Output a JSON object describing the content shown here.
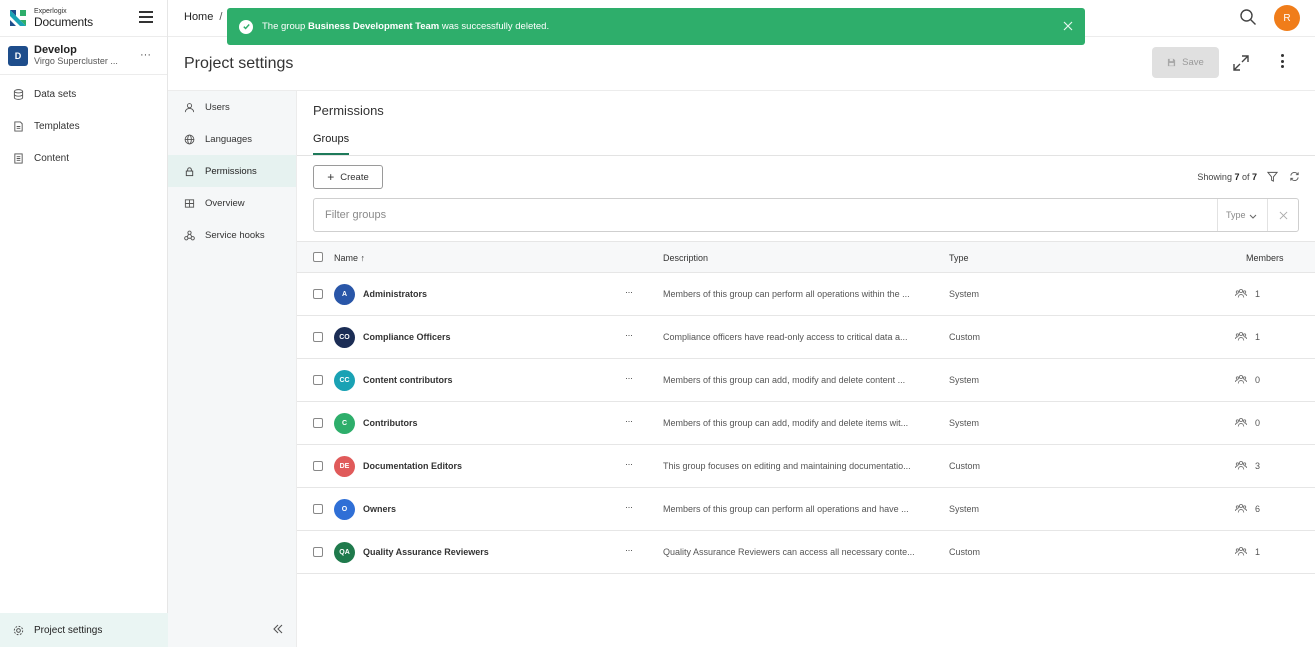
{
  "app": {
    "logo_small": "Experlogix",
    "logo_big": "Documents"
  },
  "project": {
    "badge": "D",
    "name": "Develop",
    "subtitle": "Virgo Supercluster ...",
    "more": "···"
  },
  "leftnav": {
    "items": [
      {
        "label": "Data sets",
        "icon": "database-icon"
      },
      {
        "label": "Templates",
        "icon": "template-icon"
      },
      {
        "label": "Content",
        "icon": "content-icon"
      }
    ],
    "bottom": {
      "label": "Project settings",
      "icon": "gear-icon"
    }
  },
  "header": {
    "breadcrumb_home": "Home",
    "breadcrumb_sep": "/",
    "avatar_initial": "R"
  },
  "toast": {
    "prefix": "The group ",
    "group": "Business Development Team",
    "suffix": " was successfully deleted."
  },
  "titlebar": {
    "title": "Project settings",
    "save_label": "Save"
  },
  "subnav": {
    "items": [
      {
        "label": "Users",
        "icon": "user-icon"
      },
      {
        "label": "Languages",
        "icon": "globe-icon"
      },
      {
        "label": "Permissions",
        "icon": "lock-icon"
      },
      {
        "label": "Overview",
        "icon": "grid-icon"
      },
      {
        "label": "Service hooks",
        "icon": "hooks-icon"
      }
    ]
  },
  "main": {
    "section_title": "Permissions",
    "tab": "Groups",
    "create_label": "Create",
    "showing_prefix": "Showing ",
    "showing_count": "7",
    "showing_of": " of ",
    "showing_total": "7",
    "filter_placeholder": "Filter groups",
    "type_label": "Type"
  },
  "table": {
    "headers": {
      "name": "Name ↑",
      "description": "Description",
      "type": "Type",
      "members": "Members"
    },
    "rows": [
      {
        "initials": "A",
        "color": "#2956a8",
        "name": "Administrators",
        "more": "···",
        "description": "Members of this group can perform all operations within the ...",
        "type": "System",
        "members": "1"
      },
      {
        "initials": "CO",
        "color": "#1b2d55",
        "name": "Compliance Officers",
        "more": "···",
        "description": "Compliance officers have read-only access to critical data a...",
        "type": "Custom",
        "members": "1"
      },
      {
        "initials": "CC",
        "color": "#1aa2b4",
        "name": "Content contributors",
        "more": "···",
        "description": "Members of this group can add, modify and delete content ...",
        "type": "System",
        "members": "0"
      },
      {
        "initials": "C",
        "color": "#2eae6b",
        "name": "Contributors",
        "more": "···",
        "description": "Members of this group can add, modify and delete items wit...",
        "type": "System",
        "members": "0"
      },
      {
        "initials": "DE",
        "color": "#e05a5a",
        "name": "Documentation Editors",
        "more": "···",
        "description": "This group focuses on editing and maintaining documentatio...",
        "type": "Custom",
        "members": "3"
      },
      {
        "initials": "O",
        "color": "#2f6fd6",
        "name": "Owners",
        "more": "···",
        "description": "Members of this group can perform all operations and have ...",
        "type": "System",
        "members": "6"
      },
      {
        "initials": "QA",
        "color": "#1f7a4c",
        "name": "Quality Assurance Reviewers",
        "more": "···",
        "description": "Quality Assurance Reviewers can access all necessary conte...",
        "type": "Custom",
        "members": "1"
      }
    ]
  }
}
